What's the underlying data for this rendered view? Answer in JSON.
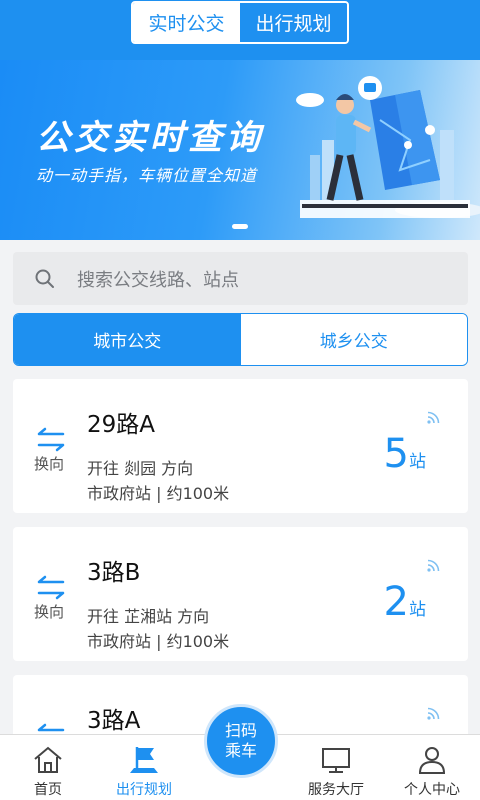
{
  "header": {
    "tabs": [
      {
        "label": "实时公交",
        "active": true
      },
      {
        "label": "出行规划",
        "active": false
      }
    ],
    "accent_color": "#1e90f0"
  },
  "banner": {
    "title": "公交实时查询",
    "subtitle": "动一动手指，车辆位置全知道"
  },
  "search": {
    "placeholder": "搜索公交线路、站点",
    "icon": "search-icon"
  },
  "category_tabs": [
    {
      "label": "城市公交",
      "active": true
    },
    {
      "label": "城乡公交",
      "active": false
    }
  ],
  "routes": [
    {
      "name": "29路A",
      "direction": "开往 剡园 方向",
      "stop": "市政府站 | 约100米",
      "stations": "5",
      "unit": "站",
      "swap_label": "换向"
    },
    {
      "name": "3路B",
      "direction": "开往 芷湘站 方向",
      "stop": "市政府站 | 约100米",
      "stations": "2",
      "unit": "站",
      "swap_label": "换向"
    },
    {
      "name": "3路A",
      "direction": "",
      "stop": "",
      "stations": "",
      "unit": "",
      "swap_label": ""
    }
  ],
  "nav": {
    "items": [
      {
        "label": "首页",
        "icon": "home-icon",
        "active": false
      },
      {
        "label": "出行规划",
        "icon": "route-flag-icon",
        "active": true
      },
      {
        "label": "服务大厅",
        "icon": "monitor-icon",
        "active": false
      },
      {
        "label": "个人中心",
        "icon": "user-icon",
        "active": false
      }
    ],
    "scan": {
      "line1": "扫码",
      "line2": "乘车"
    }
  }
}
